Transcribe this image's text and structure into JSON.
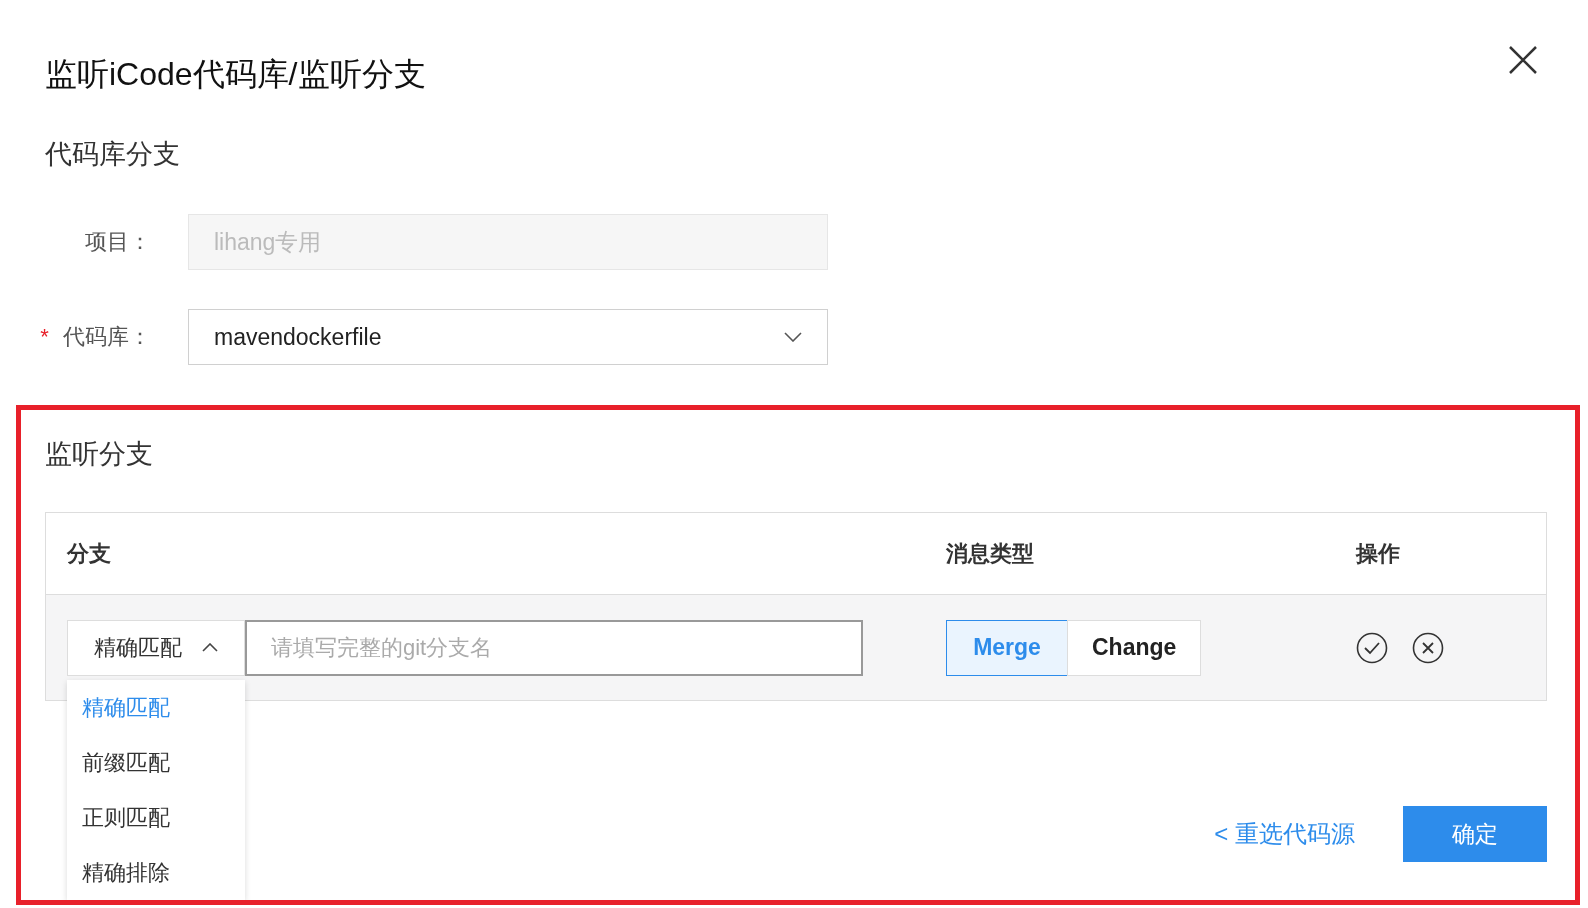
{
  "dialog": {
    "title": "监听iCode代码库/监听分支"
  },
  "repo_section": {
    "title": "代码库分支",
    "fields": [
      {
        "kind": "input",
        "label": "项目：",
        "value": "lihang专用",
        "disabled": true
      },
      {
        "kind": "select",
        "marker": "*",
        "label": "代码库：",
        "value": "mavendockerfile",
        "disabled": false
      }
    ]
  },
  "branch_section": {
    "title": "监听分支",
    "table": {
      "columns": [
        "分支",
        "消息类型",
        "操作"
      ],
      "rows": [
        {
          "match_select": {
            "value": "精确匹配",
            "expanded": true
          },
          "branch_input": {
            "placeholder": "请填写完整的git分支名"
          },
          "message_types": [
            {
              "label": "Merge",
              "selected": true
            },
            {
              "label": "Change",
              "selected": false
            }
          ]
        }
      ]
    },
    "dropdown_options": [
      {
        "label": "精确匹配",
        "selected": true
      },
      {
        "label": "前缀匹配",
        "selected": false
      },
      {
        "label": "正则匹配",
        "selected": false
      },
      {
        "label": "精确排除",
        "selected": false
      }
    ],
    "back_link": "< 重选代码源",
    "confirm_button": "确定"
  }
}
